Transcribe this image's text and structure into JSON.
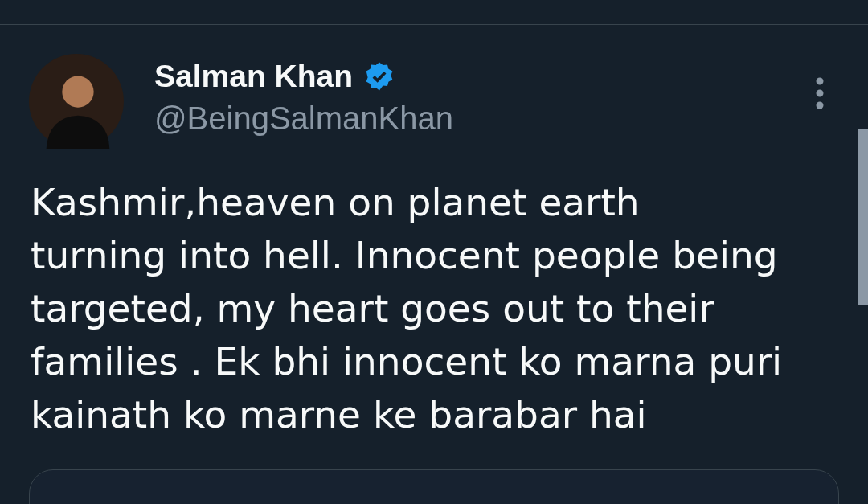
{
  "tweet": {
    "author": {
      "name": "Salman Khan",
      "verified": true,
      "handle": "@BeingSalmanKhan"
    },
    "text": "Kashmir,heaven on planet earth\nturning into hell. Innocent people being\ntargeted, my heart goes out to their\nfamilies . Ek bhi innocent ko marna puri\nkainath ko marne ke barabar hai",
    "quoted_card": {
      "kind": "card"
    }
  }
}
